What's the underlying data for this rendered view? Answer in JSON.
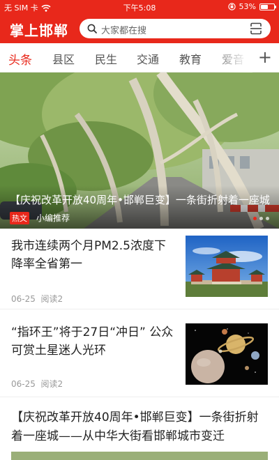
{
  "status_bar": {
    "carrier": "无 SIM 卡",
    "time": "下午5:08",
    "battery": "53%",
    "battery_level": 0.53
  },
  "header": {
    "title": "掌上邯郸",
    "search_placeholder": "大家都在搜"
  },
  "tabs": [
    {
      "label": "头条",
      "active": true
    },
    {
      "label": "县区",
      "active": false
    },
    {
      "label": "民生",
      "active": false
    },
    {
      "label": "交通",
      "active": false
    },
    {
      "label": "教育",
      "active": false
    },
    {
      "label": "爱音",
      "active": false
    }
  ],
  "add_tab_label": "+",
  "banner": {
    "title": "【庆祝改革开放40周年•邯郸巨变】一条街折射着一座城",
    "badge": "热文",
    "source": "小编推荐",
    "page_count": 3,
    "active_page": 1
  },
  "news": [
    {
      "title": "我市连续两个月PM2.5浓度下降率全省第一",
      "date": "06-25",
      "reads": "阅读2"
    },
    {
      "title": "“指环王”将于27日“冲日” 公众可赏土星迷人光环",
      "date": "06-25",
      "reads": "阅读2"
    },
    {
      "title": "【庆祝改革开放40周年•邯郸巨变】一条街折射着一座城——从中华大街看邯郸城市变迁"
    }
  ],
  "colors": {
    "brand_red": "#e8281b",
    "text_dark": "#222222",
    "text_muted": "#999999"
  }
}
